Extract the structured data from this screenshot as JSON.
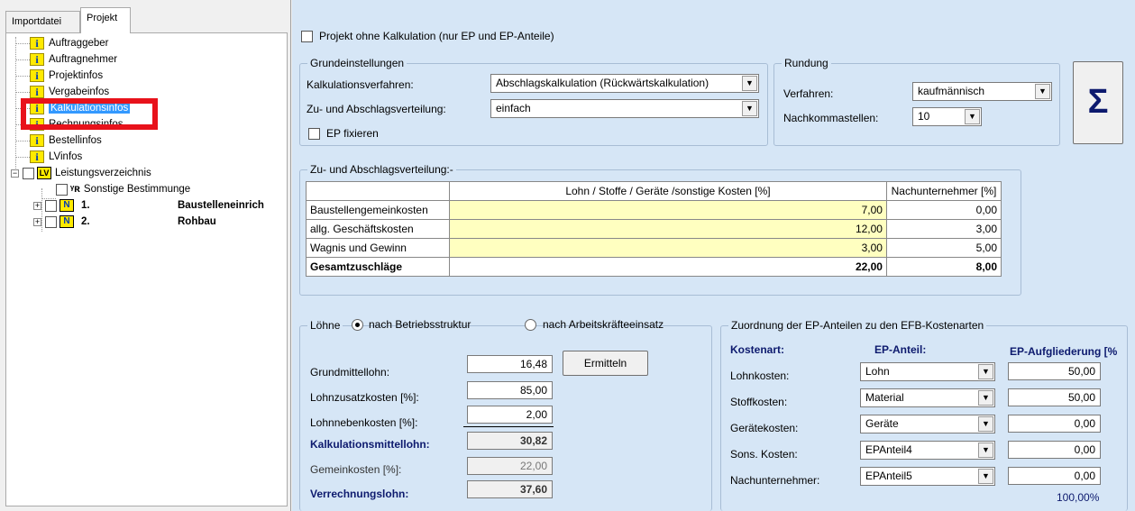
{
  "tabs": [
    "Importdatei",
    "Projekt"
  ],
  "tree": {
    "items": [
      {
        "label": "Auftraggeber"
      },
      {
        "label": "Auftragnehmer"
      },
      {
        "label": "Projektinfos"
      },
      {
        "label": "Vergabeinfos"
      },
      {
        "label": "Kalkulationsinfos"
      },
      {
        "label": "Rechnungsinfos"
      },
      {
        "label": "Bestellinfos"
      },
      {
        "label": "LVinfos"
      }
    ],
    "lv_label": "Leistungsverzeichnis",
    "lv_icon_text": "LV",
    "sonstige": "Sonstige Bestimmunge",
    "nodes": [
      {
        "num": "1.",
        "name": "Baustelleneinrich"
      },
      {
        "num": "2.",
        "name": "Rohbau"
      }
    ]
  },
  "main": {
    "ohne_kalk": "Projekt ohne Kalkulation (nur EP und EP-Anteile)",
    "grund": {
      "title": "Grundeinstellungen",
      "verfahren_label": "Kalkulationsverfahren:",
      "verfahren_value": "Abschlagskalkulation (Rückwärtskalkulation)",
      "verteilung_label": "Zu- und Abschlagsverteilung:",
      "verteilung_value": "einfach",
      "ep_fix": "EP fixieren"
    },
    "rundung": {
      "title": "Rundung",
      "verfahren_label": "Verfahren:",
      "verfahren_value": "kaufmännisch",
      "nachkomma_label": "Nachkommastellen:",
      "nachkomma_value": "10"
    },
    "sigma": "Σ",
    "zuab": {
      "title": "Zu- und Abschlagsverteilung:-",
      "headers": [
        "",
        "Lohn / Stoffe / Geräte /sonstige Kosten [%]",
        "Nachunternehmer [%]"
      ],
      "rows": [
        {
          "label": "Baustellengemeinkosten",
          "lohn": "7,00",
          "nu": "0,00"
        },
        {
          "label": "allg. Geschäftskosten",
          "lohn": "12,00",
          "nu": "3,00"
        },
        {
          "label": "Wagnis und Gewinn",
          "lohn": "3,00",
          "nu": "5,00"
        }
      ],
      "total": {
        "label": "Gesamtzuschläge",
        "lohn": "22,00",
        "nu": "8,00"
      }
    },
    "loehne": {
      "title": "Löhne",
      "radio1": "nach Betriebsstruktur",
      "radio2": "nach Arbeitskräfteeinsatz",
      "grund_label": "Grundmittellohn:",
      "grund_value": "16,48",
      "ermitteln": "Ermitteln",
      "zusatz_label": "Lohnzusatzkosten [%]:",
      "zusatz_value": "85,00",
      "neben_label": "Lohnnebenkosten [%]:",
      "neben_value": "2,00",
      "kalk_label": "Kalkulationsmittellohn:",
      "kalk_value": "30,82",
      "gemein_label": "Gemeinkosten [%]:",
      "gemein_value": "22,00",
      "verr_label": "Verrechnungslohn:",
      "verr_value": "37,60"
    },
    "zuordnung": {
      "title": "Zuordnung der EP-Anteilen zu den EFB-Kostenarten",
      "col1": "Kostenart:",
      "col2": "EP-Anteil:",
      "col3": "EP-Aufgliederung [%",
      "rows": [
        {
          "label": "Lohnkosten:",
          "anteil": "Lohn",
          "value": "50,00"
        },
        {
          "label": "Stoffkosten:",
          "anteil": "Material",
          "value": "50,00"
        },
        {
          "label": "Gerätekosten:",
          "anteil": "Geräte",
          "value": "0,00"
        },
        {
          "label": "Sons. Kosten:",
          "anteil": "EPAnteil4",
          "value": "0,00"
        },
        {
          "label": "Nachunternehmer:",
          "anteil": "EPAnteil5",
          "value": "0,00"
        }
      ],
      "sum": "100,00%"
    }
  }
}
